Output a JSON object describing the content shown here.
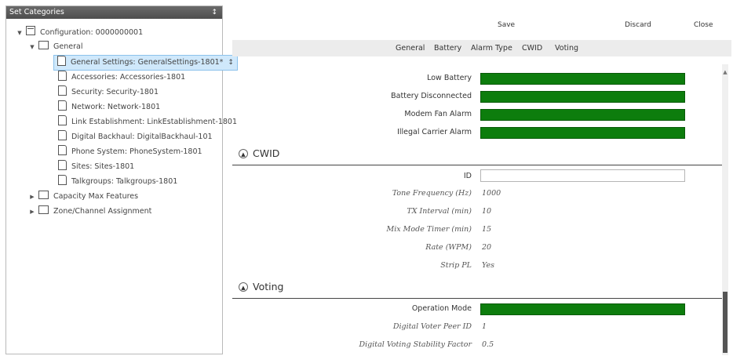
{
  "left_panel": {
    "title": "Set Categories",
    "pin": "↕",
    "tree": {
      "root": "Configuration: 0000000001",
      "general": "General",
      "items": [
        "General Settings: GeneralSettings-1801*",
        "Accessories: Accessories-1801",
        "Security: Security-1801",
        "Network: Network-1801",
        "Link Establishment: LinkEstablishment-1801",
        "Digital Backhaul: DigitalBackhaul-101",
        "Phone System: PhoneSystem-1801",
        "Sites: Sites-1801",
        "Talkgroups: Talkgroups-1801"
      ],
      "capacity": "Capacity Max Features",
      "zone": "Zone/Channel Assignment"
    }
  },
  "toolbar": {
    "save": "Save",
    "discard": "Discard",
    "close": "Close"
  },
  "tabs": [
    "General",
    "Battery",
    "Alarm Type",
    "CWID",
    "Voting"
  ],
  "alarms": [
    "Low Battery",
    "Battery Disconnected",
    "Modem Fan Alarm",
    "Illegal Carrier Alarm"
  ],
  "cwid": {
    "title": "CWID",
    "id_label": "ID",
    "id_value": "",
    "fields": [
      {
        "label": "Tone Frequency (Hz)",
        "value": "1000"
      },
      {
        "label": "TX Interval (min)",
        "value": "10"
      },
      {
        "label": "Mix Mode Timer (min)",
        "value": "15"
      },
      {
        "label": "Rate (WPM)",
        "value": "20"
      },
      {
        "label": "Strip PL",
        "value": "Yes"
      }
    ]
  },
  "voting": {
    "title": "Voting",
    "operation_mode_label": "Operation Mode",
    "fields": [
      {
        "label": "Digital Voter Peer ID",
        "value": "1"
      },
      {
        "label": "Digital Voting Stability Factor",
        "value": "0.5"
      }
    ]
  },
  "colors": {
    "green_field": "#0d7d0d",
    "header": "#555555",
    "selection": "#cfe8fb"
  }
}
